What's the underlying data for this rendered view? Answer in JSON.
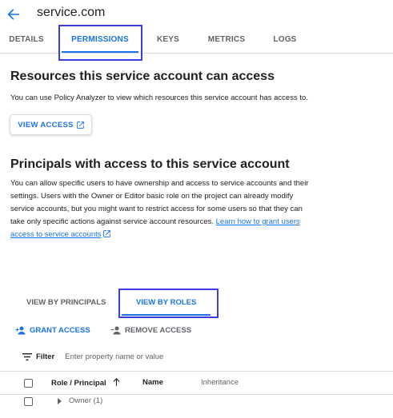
{
  "header": {
    "title": "service.com"
  },
  "tabs": [
    {
      "label": "DETAILS"
    },
    {
      "label": "PERMISSIONS"
    },
    {
      "label": "KEYS"
    },
    {
      "label": "METRICS"
    },
    {
      "label": "LOGS"
    }
  ],
  "active_tab": "PERMISSIONS",
  "resources": {
    "heading": "Resources this service account can access",
    "description": "You can use Policy Analyzer to view which resources this service account has access to.",
    "view_access_label": "VIEW ACCESS"
  },
  "principals": {
    "heading": "Principals with access to this service account",
    "desc_line1": "You can allow specific users to have ownership and access to service accounts and their",
    "desc_line2": "settings. Users with the Owner or Editor basic role on the project can already modify",
    "desc_line3": "service accounts, but you might want to restrict access for some users so that they can",
    "desc_line4": "take only specific actions against service account resources.",
    "link_part1": "Learn how to grant users",
    "link_part2": "access to service accounts"
  },
  "view_tabs": [
    {
      "label": "VIEW BY PRINCIPALS"
    },
    {
      "label": "VIEW BY ROLES"
    }
  ],
  "active_view_tab": "VIEW BY ROLES",
  "actions": {
    "grant": "GRANT ACCESS",
    "remove": "REMOVE ACCESS"
  },
  "filter": {
    "label": "Filter",
    "placeholder": "Enter property name or value"
  },
  "table": {
    "columns": [
      "Role / Principal",
      "Name",
      "Inheritance"
    ],
    "rows": [
      {
        "label": "Owner (1)"
      }
    ]
  },
  "colors": {
    "accent": "#1a73e8",
    "highlight_box": "#3c3ce0"
  }
}
